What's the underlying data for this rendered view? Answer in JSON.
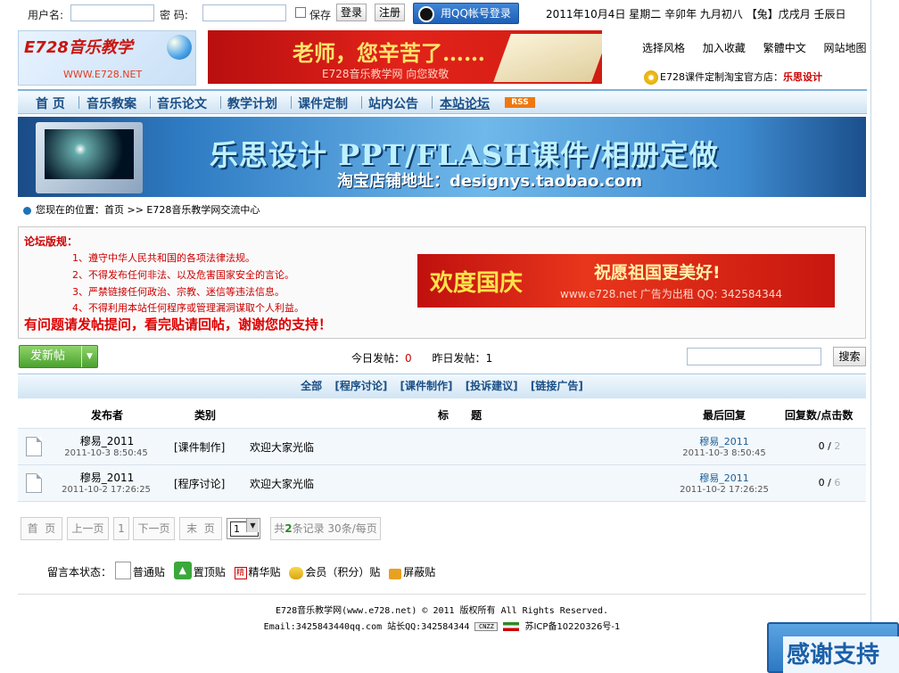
{
  "login": {
    "username_label": "用户名:",
    "password_label": "密   码:",
    "remember_label": "保存",
    "login_button": "登录",
    "register_button": "注册",
    "qq_login_button": "用QQ帐号登录"
  },
  "date_text": "2011年10月4日  星期二   辛卯年  九月初八 【兔】戊戌月  壬辰日",
  "logo": {
    "title": "E728音乐教学",
    "url": "WWW.E728.NET"
  },
  "banner1": {
    "headline": "老师，您辛苦了……",
    "sub": "E728音乐教学网 向您致敬"
  },
  "top_links": [
    "选择风格",
    "加入收藏",
    "繁體中文",
    "网站地图"
  ],
  "taobao": {
    "prefix": "E728课件定制淘宝官方店：",
    "shop": "乐思设计"
  },
  "nav": {
    "items": [
      "首  页",
      "音乐教案",
      "音乐论文",
      "教学计划",
      "课件定制",
      "站内公告",
      "本站论坛"
    ],
    "rss": "RSS"
  },
  "banner2": {
    "headline": "乐思设计  PPT/FLASH课件/相册定做",
    "sub": "淘宝店铺地址：designys.taobao.com"
  },
  "breadcrumb": "您现在的位置：首页 >> E728音乐教学网交流中心",
  "rules": {
    "title": "论坛版规：",
    "items": [
      "1、遵守中华人民共和国的各项法律法规。",
      "2、不得发布任何非法、以及危害国家安全的言论。",
      "3、严禁链接任何政治、宗教、迷信等违法信息。",
      "4、不得利用本站任何程序或管理漏洞谋取个人利益。"
    ],
    "notice": "有问题请发帖提问，看完贴请回帖，谢谢您的支持！"
  },
  "ad": {
    "left": "欢度国庆",
    "right": "祝愿祖国更美好!",
    "sub": "www.e728.net 广告为出租 QQ: 342584344"
  },
  "toolbar": {
    "new_post": "发新帖",
    "today_label": "今日发帖：",
    "today_count": "0",
    "yesterday_label": "昨日发帖：",
    "yesterday_count": "1",
    "search_button": "搜索"
  },
  "filters": [
    "全部",
    "[程序讨论]",
    "[课件制作]",
    "[投诉建议]",
    "[链接广告]"
  ],
  "table": {
    "headers": {
      "author": "发布者",
      "category": "类别",
      "title": "标      题",
      "last_reply": "最后回复",
      "stats": "回复数/点击数"
    },
    "rows": [
      {
        "author": "穆易_2011",
        "time": "2011-10-3 8:50:45",
        "category": "[课件制作]",
        "title": "欢迎大家光临",
        "last_author": "穆易_2011",
        "last_time": "2011-10-3 8:50:45",
        "replies": "0",
        "clicks": "2"
      },
      {
        "author": "穆易_2011",
        "time": "2011-10-2 17:26:25",
        "category": "[程序讨论]",
        "title": "欢迎大家光临",
        "last_author": "穆易_2011",
        "last_time": "2011-10-2 17:26:25",
        "replies": "0",
        "clicks": "6"
      }
    ]
  },
  "pagination": {
    "first": "首  页",
    "prev": "上一页",
    "current": "1",
    "next": "下一页",
    "last": "末  页",
    "select": "1",
    "total_prefix": "共",
    "total": "2",
    "total_suffix": "条记录 30条/每页"
  },
  "legend": {
    "label": "留言本状态：",
    "items": [
      "普通贴",
      "置顶贴",
      "精华贴",
      "会员（积分）贴",
      "屏蔽贴"
    ]
  },
  "footer": {
    "line1": "E728音乐教学网(www.e728.net) © 2011 版权所有 All Rights Reserved.",
    "line2": "Email:3425843440qq.com 站长QQ:342584344",
    "icp": "苏ICP备10220326号-1"
  },
  "thanks": "感谢支持"
}
